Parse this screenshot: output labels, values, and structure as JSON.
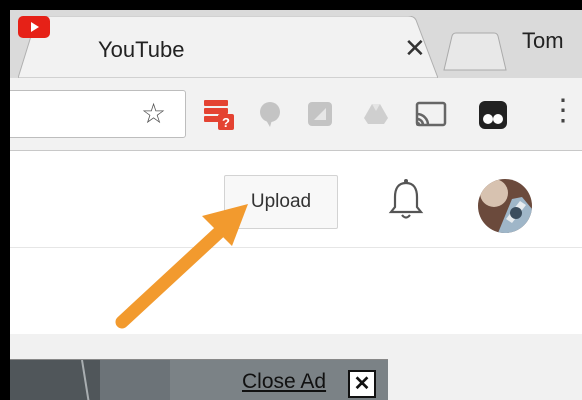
{
  "browser": {
    "tab": {
      "title": "YouTube",
      "close_glyph": "✕"
    },
    "profile_name": "Tom"
  },
  "toolbar": {
    "star_glyph": "☆",
    "extensions": [
      "todoist-icon",
      "chat-bubble-icon",
      "square-extension-icon",
      "drive-icon",
      "cast-icon",
      "tampermonkey-icon"
    ],
    "menu_glyph": "⋮"
  },
  "youtube": {
    "upload_label": "Upload"
  },
  "ad": {
    "close_label": "Close Ad",
    "close_glyph": "✕"
  },
  "colors": {
    "youtube_red": "#e62117",
    "arrow": "#f29a2e"
  }
}
